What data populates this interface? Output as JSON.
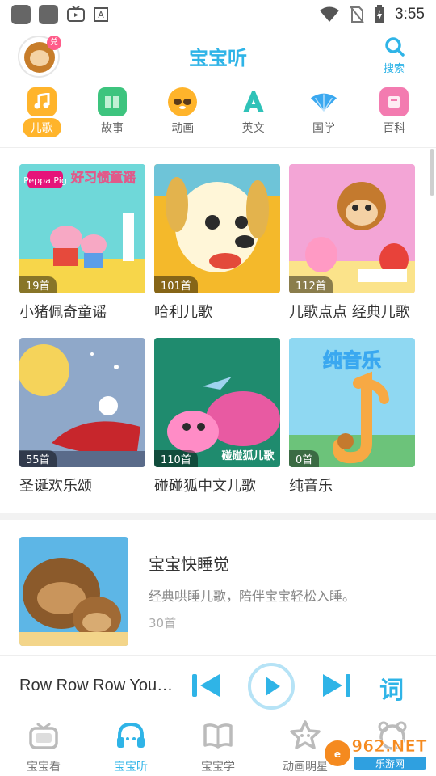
{
  "status_bar": {
    "time": "3:55"
  },
  "header": {
    "title": "宝宝听",
    "avatar_badge": "兑",
    "search_label": "搜索"
  },
  "categories": [
    {
      "label": "儿歌",
      "icon": "music-note-icon",
      "color": "#ffb42b",
      "active": true
    },
    {
      "label": "故事",
      "icon": "book-icon",
      "color": "#3dc47e",
      "active": false
    },
    {
      "label": "动画",
      "icon": "panda-icon",
      "color": "#ffb42b",
      "active": false
    },
    {
      "label": "英文",
      "icon": "letter-a-icon",
      "color": "#2fc2b8",
      "active": false
    },
    {
      "label": "国学",
      "icon": "fan-icon",
      "color": "#3aa8f0",
      "active": false
    },
    {
      "label": "百科",
      "icon": "encyclopedia-icon",
      "color": "#f37bb0",
      "active": false
    }
  ],
  "albums": [
    {
      "title": "小猪佩奇童谣",
      "count": "19首",
      "cover_text": "好习惯童谣",
      "cover_brand": "Peppa Pig"
    },
    {
      "title": "哈利儿歌",
      "count": "101首"
    },
    {
      "title": "儿歌点点 经典儿歌",
      "count": "112首"
    },
    {
      "title": "圣诞欢乐颂",
      "count": "55首"
    },
    {
      "title": "碰碰狐中文儿歌",
      "count": "110首",
      "cover_text": "碰碰狐儿歌"
    },
    {
      "title": "纯音乐",
      "count": "0首",
      "cover_text": "纯音乐"
    }
  ],
  "featured": {
    "title": "宝宝快睡觉",
    "description": "经典哄睡儿歌，陪伴宝宝轻松入睡。",
    "count": "30首"
  },
  "player": {
    "now_playing": "Row Row Row Your Boat",
    "lyrics_label": "词"
  },
  "bottom_nav": [
    {
      "label": "宝宝看",
      "icon": "tv-icon",
      "active": false
    },
    {
      "label": "宝宝听",
      "icon": "headphones-icon",
      "active": true
    },
    {
      "label": "宝宝学",
      "icon": "open-book-icon",
      "active": false
    },
    {
      "label": "动画明星",
      "icon": "star-face-icon",
      "active": false
    },
    {
      "label": "",
      "icon": "bear-icon",
      "active": false
    }
  ],
  "watermark": {
    "text": "962.NET",
    "subtext": "乐游网"
  },
  "colors": {
    "accent": "#2fb4e7",
    "active_tab": "#ffb42b"
  }
}
